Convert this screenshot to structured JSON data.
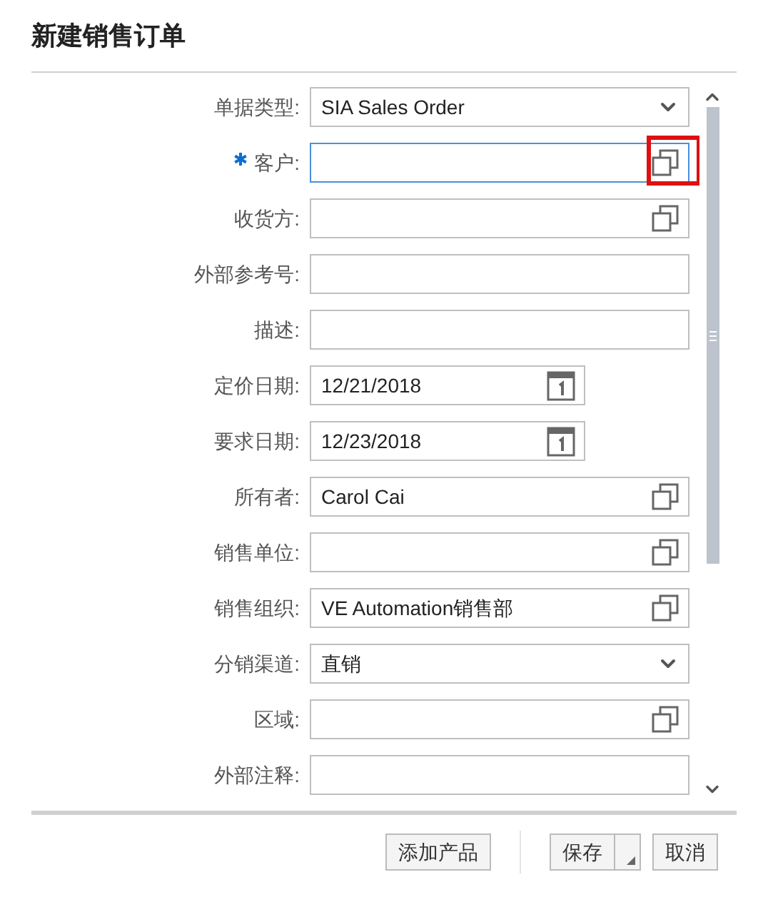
{
  "title": "新建销售订单",
  "fields": [
    {
      "label": "单据类型:",
      "kind": "select",
      "value": "SIA Sales Order",
      "required": false,
      "focused": false,
      "highlighted": false
    },
    {
      "label": "客户:",
      "kind": "lookup",
      "required": true,
      "focused": true,
      "highlighted": true
    },
    {
      "label": "收货方:",
      "kind": "lookup",
      "required": false,
      "focused": false,
      "highlighted": false
    },
    {
      "label": "外部参考号:",
      "kind": "text",
      "required": false,
      "focused": false,
      "highlighted": false
    },
    {
      "label": "描述:",
      "kind": "text",
      "required": false,
      "focused": false,
      "highlighted": false
    },
    {
      "label": "定价日期:",
      "kind": "date",
      "value": "12/21/2018",
      "required": false,
      "focused": false,
      "highlighted": false
    },
    {
      "label": "要求日期:",
      "kind": "date",
      "value": "12/23/2018",
      "required": false,
      "focused": false,
      "highlighted": false
    },
    {
      "label": "所有者:",
      "kind": "lookup",
      "value": "Carol Cai",
      "required": false,
      "focused": false,
      "highlighted": false
    },
    {
      "label": "销售单位:",
      "kind": "lookup",
      "required": false,
      "focused": false,
      "highlighted": false
    },
    {
      "label": "销售组织:",
      "kind": "lookup",
      "value": "VE Automation销售部",
      "required": false,
      "focused": false,
      "highlighted": false
    },
    {
      "label": "分销渠道:",
      "kind": "select",
      "value": "直销",
      "required": false,
      "focused": false,
      "highlighted": false
    },
    {
      "label": "区域:",
      "kind": "lookup",
      "required": false,
      "focused": false,
      "highlighted": false
    },
    {
      "label": "外部注释:",
      "kind": "text",
      "required": false,
      "focused": false,
      "highlighted": false
    }
  ],
  "buttons": [
    {
      "label": "添加产品",
      "kind": "plain"
    },
    {
      "label": "保存",
      "kind": "split"
    },
    {
      "label": "取消",
      "kind": "plain"
    }
  ]
}
